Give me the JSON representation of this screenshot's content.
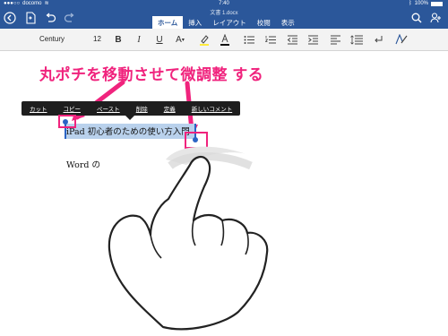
{
  "status": {
    "carrier": "docomo",
    "time": "7:40",
    "battery": "100%"
  },
  "window": {
    "doc_title": "文書 1.docx"
  },
  "tabs": [
    {
      "label": "ホーム",
      "active": true
    },
    {
      "label": "挿入",
      "active": false
    },
    {
      "label": "レイアウト",
      "active": false
    },
    {
      "label": "校閲",
      "active": false
    },
    {
      "label": "表示",
      "active": false
    }
  ],
  "ribbon": {
    "font_name": "Century",
    "font_size": "12",
    "bold": "B",
    "italic": "I",
    "underline": "U",
    "font_effects": "A"
  },
  "annotation": {
    "headline": "丸ポチを移動させて微調整 する",
    "accent_color": "#f0237d"
  },
  "context_menu": {
    "items": [
      "カット",
      "コピー",
      "ペースト",
      "削除",
      "定義",
      "新しいコメント"
    ]
  },
  "document": {
    "line1": "iPad 初心者のための使い方入門",
    "line2": "Word の"
  },
  "colors": {
    "brand": "#2b579a",
    "selection": "#b9d1ec",
    "handle": "#2a64c5"
  }
}
